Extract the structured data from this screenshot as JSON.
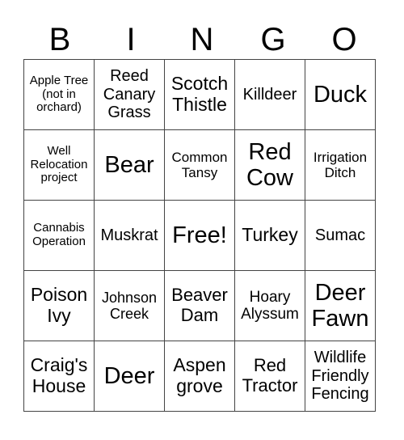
{
  "header": [
    "B",
    "I",
    "N",
    "G",
    "O"
  ],
  "cells": [
    [
      "Apple Tree (not in orchard)",
      "Reed Canary Grass",
      "Scotch Thistle",
      "Killdeer",
      "Duck"
    ],
    [
      "Well Relocation project",
      "Bear",
      "Common Tansy",
      "Red Cow",
      "Irrigation Ditch"
    ],
    [
      "Cannabis Operation",
      "Muskrat",
      "Free!",
      "Turkey",
      "Sumac"
    ],
    [
      "Poison Ivy",
      "Johnson Creek",
      "Beaver Dam",
      "Hoary Alyssum",
      "Deer Fawn"
    ],
    [
      "Craig's House",
      "Deer",
      "Aspen grove",
      "Red Tractor",
      "Wildlife Friendly Fencing"
    ]
  ]
}
